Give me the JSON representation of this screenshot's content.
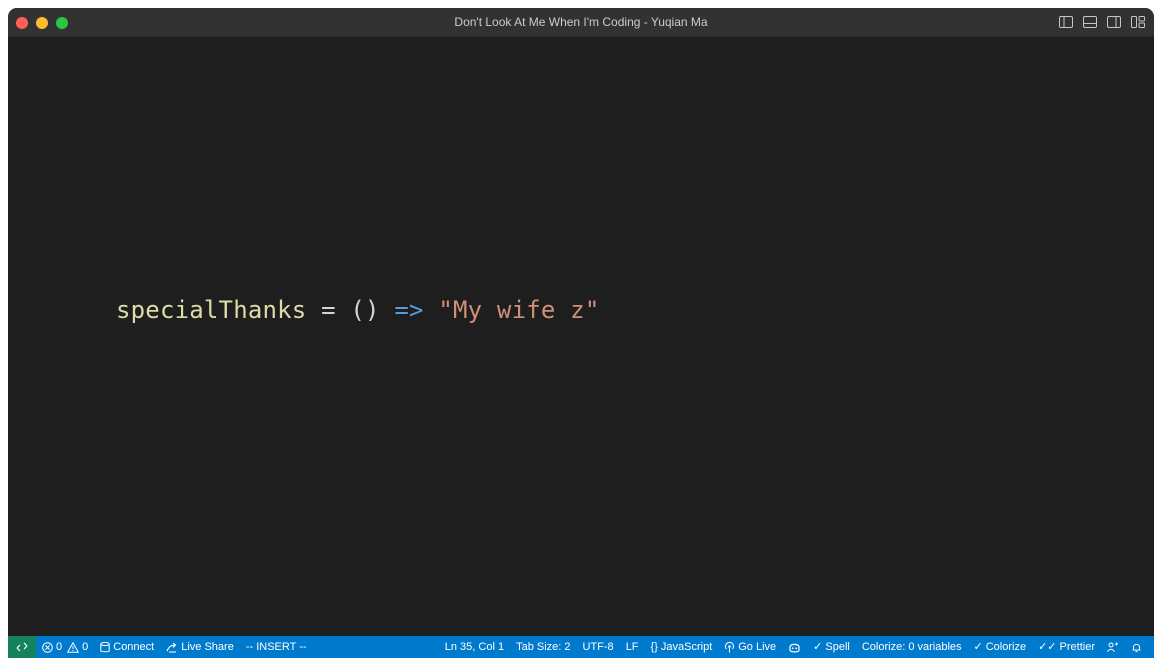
{
  "window": {
    "title": "Don't Look At Me When I'm Coding - Yuqian Ma",
    "traffic_lights": {
      "close_color": "#ff5f57",
      "minimize_color": "#febc2e",
      "zoom_color": "#28c840"
    },
    "layout_controls": [
      "toggle-primary-sidebar-icon",
      "toggle-panel-icon",
      "toggle-secondary-sidebar-icon",
      "customize-layout-icon"
    ]
  },
  "editor": {
    "code": {
      "identifier": "specialThanks",
      "assign": " = ",
      "params": "()",
      "arrow": " => ",
      "string": "\"My wife z\""
    },
    "colors": {
      "background": "#1e1e1e",
      "identifier": "#dcdcaa",
      "operator": "#d4d4d4",
      "keyword": "#569cd6",
      "string": "#ce9178"
    }
  },
  "statusbar": {
    "background": "#007acc",
    "remote_icon": "remote-icon",
    "errors": "0",
    "warnings": "0",
    "connect": "Connect",
    "live_share": "Live Share",
    "mode": "-- INSERT --",
    "cursor": "Ln 35, Col 1",
    "tab_size": "Tab Size: 2",
    "encoding": "UTF-8",
    "eol": "LF",
    "language": "JavaScript",
    "go_live": "Go Live",
    "spell": "Spell",
    "colorize_vars": "Colorize: 0 variables",
    "colorize": "Colorize",
    "prettier": "Prettier"
  }
}
